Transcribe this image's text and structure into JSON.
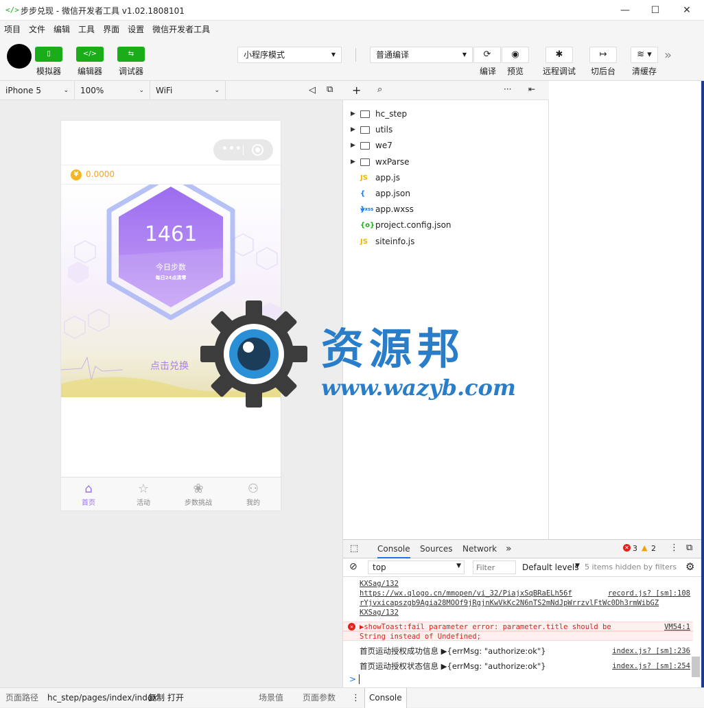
{
  "window": {
    "title": "步步兑现 - 微信开发者工具 v1.02.1808101",
    "logo_glyph": "</>",
    "minimize": "—",
    "maximize": "☐",
    "close": "✕"
  },
  "menu": [
    "项目",
    "文件",
    "编辑",
    "工具",
    "界面",
    "设置",
    "微信开发者工具"
  ],
  "toolbar": {
    "simulator_label": "模拟器",
    "editor_label": "编辑器",
    "debugger_label": "调试器",
    "mode_select": "小程序模式",
    "compile_select": "普通编译",
    "compile_label": "编译",
    "preview_label": "预览",
    "remote_debug_label": "远程调试",
    "background_label": "切后台",
    "clear_cache_label": "清缓存",
    "more": "»"
  },
  "device_bar": {
    "device": "iPhone 5",
    "zoom": "100%",
    "network": "WiFi"
  },
  "phone": {
    "coin_value": "0.0000",
    "steps": "1461",
    "steps_label": "今日步数",
    "steps_sub": "每日24点清零",
    "exchange_button": "点击兑换",
    "tabs": [
      {
        "label": "首页",
        "icon": "home-icon",
        "active": true
      },
      {
        "label": "活动",
        "icon": "star-icon",
        "active": false
      },
      {
        "label": "步数挑战",
        "icon": "challenge-icon",
        "active": false
      },
      {
        "label": "我的",
        "icon": "user-icon",
        "active": false
      }
    ]
  },
  "watermark": {
    "text": "资源邦",
    "url": "www.wazyb.com"
  },
  "files": [
    {
      "name": "hc_step",
      "type": "folder"
    },
    {
      "name": "utils",
      "type": "folder"
    },
    {
      "name": "we7",
      "type": "folder"
    },
    {
      "name": "wxParse",
      "type": "folder"
    },
    {
      "name": "app.js",
      "type": "js"
    },
    {
      "name": "app.json",
      "type": "json"
    },
    {
      "name": "app.wxss",
      "type": "wxss"
    },
    {
      "name": "project.config.json",
      "type": "config"
    },
    {
      "name": "siteinfo.js",
      "type": "js"
    }
  ],
  "file_icons": {
    "js": "JS",
    "json": "{ }",
    "wxss": "wxss",
    "config": "{o}"
  },
  "devtools": {
    "tabs": [
      "Console",
      "Sources",
      "Network"
    ],
    "more": "»",
    "error_count": "3",
    "warning_count": "2",
    "context": "top",
    "filter_placeholder": "Filter",
    "levels": "Default levels",
    "hidden": "5 items hidden by filters",
    "logs": [
      {
        "text": "KXSag/132",
        "src": "",
        "kind": "link"
      },
      {
        "text": "https://wx.qlogo.cn/mmopen/vi_32/PiajxSqBRaELh56f",
        "src": "record.js? [sm]:108",
        "kind": "link"
      },
      {
        "text": "rYjvxicapszgb9Agia28MOOf9jRgjnKwVkKc2N6nTS2mNdJpWrrzvlFtWc0Dh3rmWibGZ",
        "src": "",
        "kind": "link"
      },
      {
        "text": "KXSag/132",
        "src": "",
        "kind": "link"
      },
      {
        "text": "▶showToast:fail parameter error: parameter.title should be",
        "src": "VM54:1",
        "kind": "error"
      },
      {
        "text": "String instead of Undefined;",
        "src": "",
        "kind": "error"
      },
      {
        "text": "首页运动授权成功信息 ▶{errMsg: \"authorize:ok\"}",
        "src": "index.js? [sm]:236",
        "kind": "info"
      },
      {
        "text": "首页运动授权状态信息 ▶{errMsg: \"authorize:ok\"}",
        "src": "index.js? [sm]:254",
        "kind": "info"
      }
    ],
    "prompt": ">"
  },
  "bottom": {
    "path_label": "页面路径",
    "path": "hc_step/pages/index/index",
    "copy": "复制",
    "open": "打开",
    "scene": "场景值",
    "params": "页面参数",
    "console_tab": "Console"
  }
}
